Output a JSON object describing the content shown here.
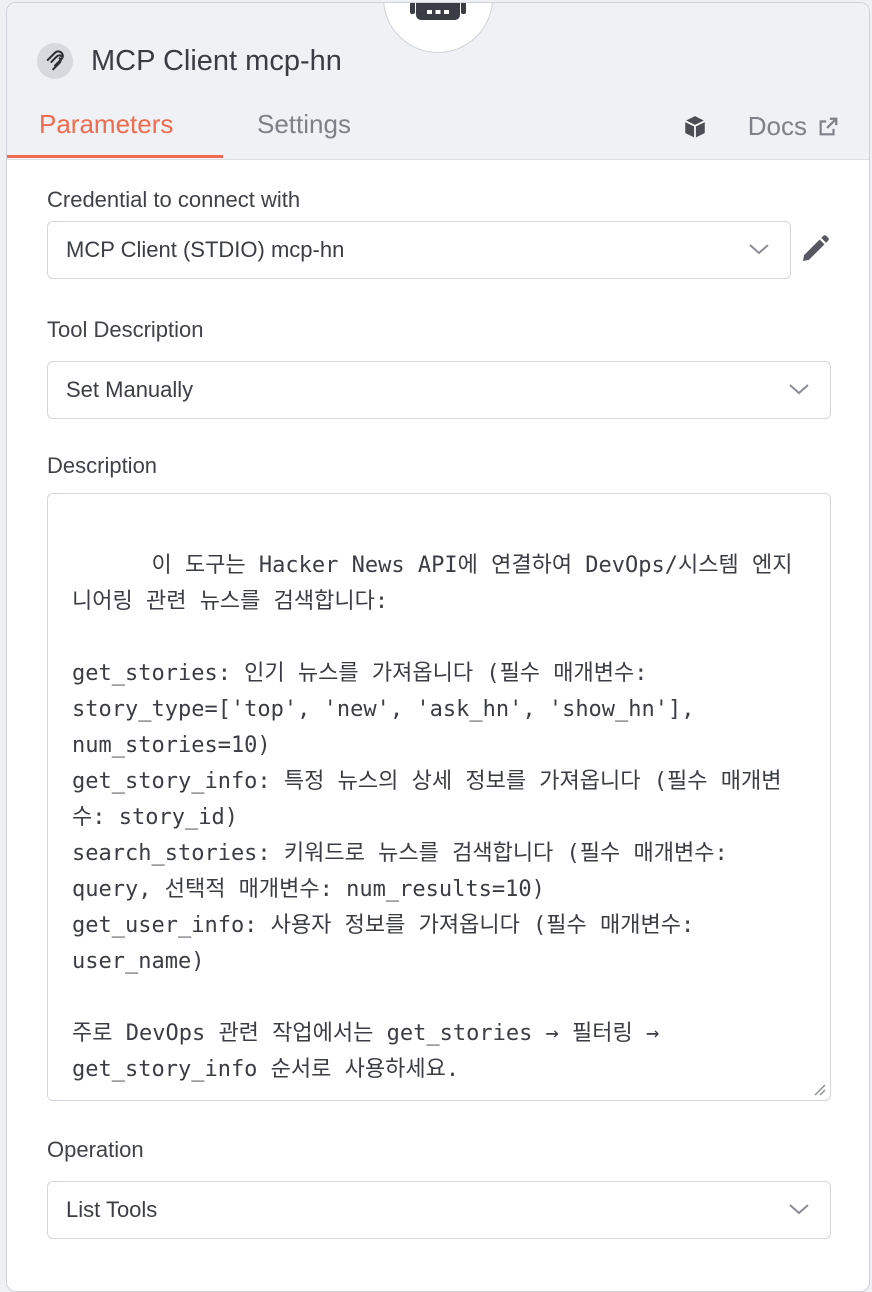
{
  "node": {
    "title": "MCP Client mcp-hn"
  },
  "tabs": [
    {
      "label": "Parameters",
      "active": true
    },
    {
      "label": "Settings",
      "active": false
    }
  ],
  "docs": {
    "label": "Docs"
  },
  "fields": {
    "credential": {
      "label": "Credential to connect with",
      "value": "MCP Client (STDIO) mcp-hn"
    },
    "tool_description": {
      "label": "Tool Description",
      "value": "Set Manually"
    },
    "description": {
      "label": "Description",
      "value": "이 도구는 Hacker News API에 연결하여 DevOps/시스템 엔지니어링 관련 뉴스를 검색합니다:\n\nget_stories: 인기 뉴스를 가져옵니다 (필수 매개변수: story_type=['top', 'new', 'ask_hn', 'show_hn'], num_stories=10)\nget_story_info: 특정 뉴스의 상세 정보를 가져옵니다 (필수 매개변수: story_id)\nsearch_stories: 키워드로 뉴스를 검색합니다 (필수 매개변수: query, 선택적 매개변수: num_results=10)\nget_user_info: 사용자 정보를 가져옵니다 (필수 매개변수: user_name)\n\n주로 DevOps 관련 작업에서는 get_stories → 필터링 → get_story_info 순서로 사용하세요."
    },
    "operation": {
      "label": "Operation",
      "value": "List Tools"
    }
  },
  "icons": {
    "node": "mcp-icon",
    "badge": "robot-icon",
    "docs_cube": "cube-icon",
    "docs_external": "external-link-icon",
    "edit": "pencil-icon",
    "dropdown": "chevron-down-icon"
  },
  "colors": {
    "accent": "#ee6b4f",
    "header_bg": "#eff1f5",
    "text": "#3a3d44",
    "muted": "#7e8188"
  }
}
